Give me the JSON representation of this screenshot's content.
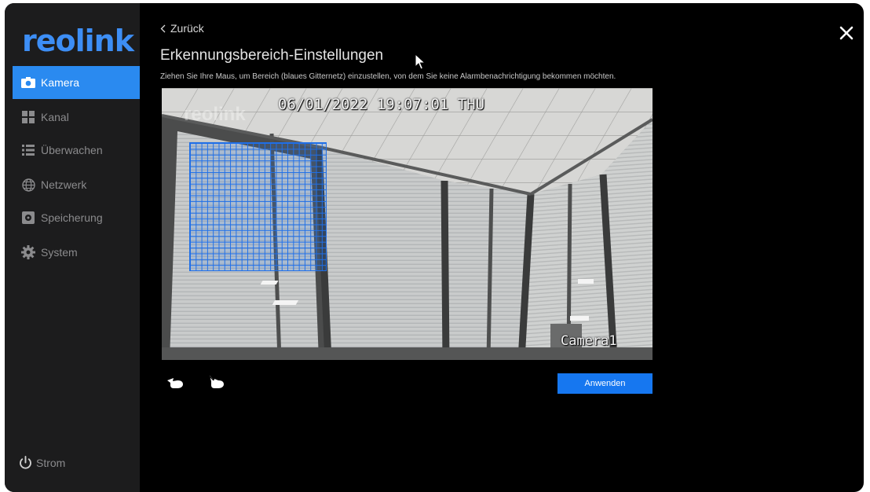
{
  "sidebar": {
    "logo": "reolink",
    "items": [
      {
        "label": "Kamera",
        "icon": "camera-icon",
        "active": true
      },
      {
        "label": "Kanal",
        "icon": "grid-icon",
        "active": false
      },
      {
        "label": "Überwachen",
        "icon": "list-icon",
        "active": false
      },
      {
        "label": "Netzwerk",
        "icon": "globe-icon",
        "active": false
      },
      {
        "label": "Speicherung",
        "icon": "storage-icon",
        "active": false
      },
      {
        "label": "System",
        "icon": "gear-icon",
        "active": false
      }
    ],
    "power_label": "Strom"
  },
  "header": {
    "back_label": "Zurück",
    "title": "Erkennungsbereich-Einstellungen",
    "subtitle": "Ziehen Sie Ihre Maus, um Bereich (blaues Gitternetz) einzustellen, von dem Sie keine Alarmbenachrichtigung bekommen möchten."
  },
  "video": {
    "timestamp": "06/01/2022 19:07:01 THU",
    "watermark": "reolink",
    "camera_name": "Camera1"
  },
  "tools": {
    "draw_icon": "draw-area-icon",
    "erase_icon": "erase-area-icon"
  },
  "actions": {
    "apply_label": "Anwenden"
  },
  "colors": {
    "accent": "#2a8af0",
    "grid": "#1f6fe8",
    "sidebar_bg": "#1c1c1d",
    "background": "#000000"
  }
}
